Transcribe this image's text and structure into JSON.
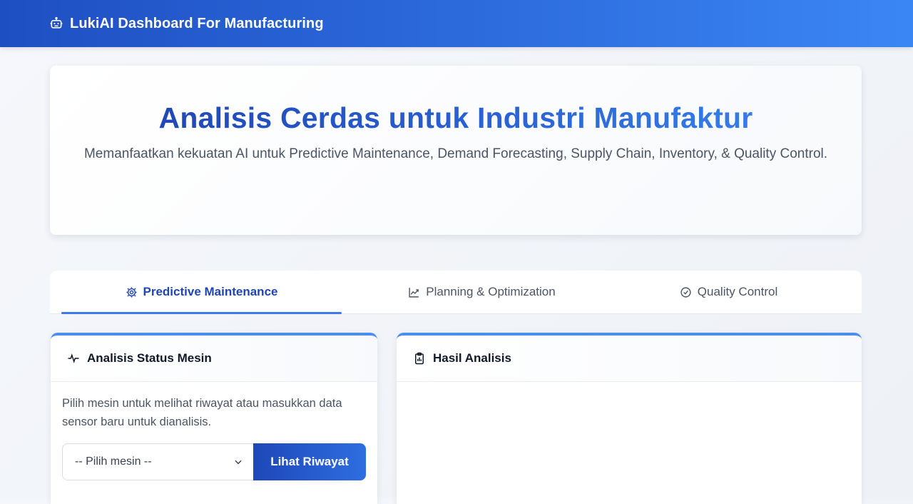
{
  "header": {
    "title": "LukiAI Dashboard For Manufacturing",
    "icon": "robot-icon"
  },
  "hero": {
    "title": "Analisis Cerdas untuk Industri Manufaktur",
    "subtitle": "Memanfaatkan kekuatan AI untuk Predictive Maintenance, Demand Forecasting, Supply Chain, Inventory, & Quality Control."
  },
  "tabs": [
    {
      "label": "Predictive Maintenance",
      "icon": "gear-icon",
      "active": true
    },
    {
      "label": "Planning & Optimization",
      "icon": "chart-line-icon",
      "active": false
    },
    {
      "label": "Quality Control",
      "icon": "check-circle-icon",
      "active": false
    }
  ],
  "machine_panel": {
    "title": "Analisis Status Mesin",
    "icon": "pulse-icon",
    "description": "Pilih mesin untuk melihat riwayat atau masukkan data sensor baru untuk dianalisis.",
    "select_value": "-- Pilih mesin --",
    "button_label": "Lihat Riwayat"
  },
  "result_panel": {
    "title": "Hasil Analisis",
    "icon": "clipboard-chart-icon"
  },
  "colors": {
    "primary": "#1e47b8",
    "accent": "#3b7ae8",
    "header_start": "#1e4fc2",
    "header_end": "#3b86f5"
  }
}
